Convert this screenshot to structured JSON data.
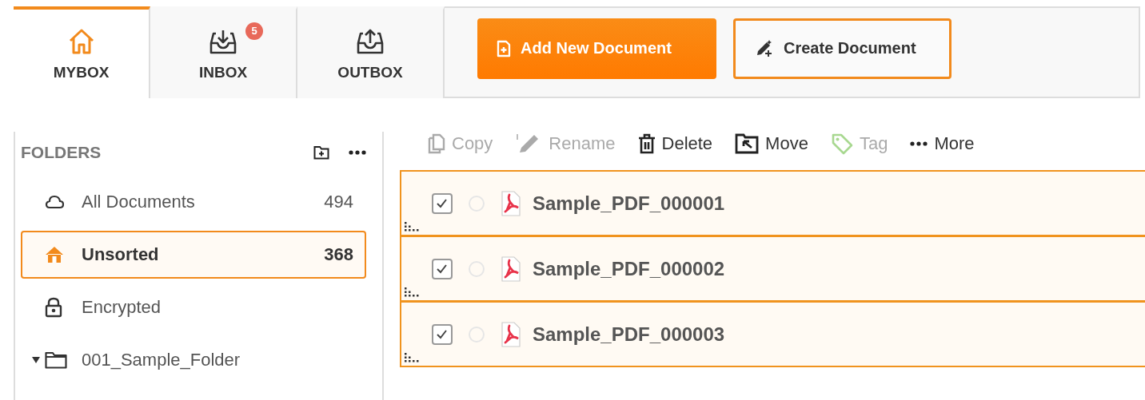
{
  "tabs": [
    {
      "kind": "home",
      "label": "MYBOX",
      "selected": true
    },
    {
      "kind": "inbox",
      "label": "INBOX",
      "selected": false,
      "badge": "5"
    },
    {
      "kind": "outbox",
      "label": "OUTBOX",
      "selected": false
    }
  ],
  "actions": [
    {
      "kind": "primary",
      "label": "Add New Document"
    },
    {
      "kind": "outline",
      "label": "Create Document"
    }
  ],
  "folders": {
    "title": "FOLDERS",
    "items": [
      {
        "kind": "cloud",
        "label": "All Documents",
        "count": "494",
        "selected": false
      },
      {
        "kind": "home",
        "label": "Unsorted",
        "count": "368",
        "selected": true
      },
      {
        "kind": "lock",
        "label": "Encrypted",
        "selected": false
      },
      {
        "kind": "folder",
        "label": "001_Sample_Folder",
        "selected": false,
        "expanded": true
      }
    ]
  },
  "toolbar": [
    {
      "kind": "copy",
      "label": "Copy",
      "disabled": true
    },
    {
      "kind": "rename",
      "label": "Rename",
      "disabled": true
    },
    {
      "kind": "delete",
      "label": "Delete",
      "disabled": false
    },
    {
      "kind": "move",
      "label": "Move",
      "disabled": false
    },
    {
      "kind": "tag",
      "label": "Tag",
      "disabled": true
    },
    {
      "kind": "more",
      "label": "More",
      "disabled": false
    }
  ],
  "documents": [
    {
      "name": "Sample_PDF_000001",
      "checked": true,
      "selected": true
    },
    {
      "name": "Sample_PDF_000002",
      "checked": true,
      "selected": true
    },
    {
      "name": "Sample_PDF_000003",
      "checked": true,
      "selected": true
    }
  ]
}
